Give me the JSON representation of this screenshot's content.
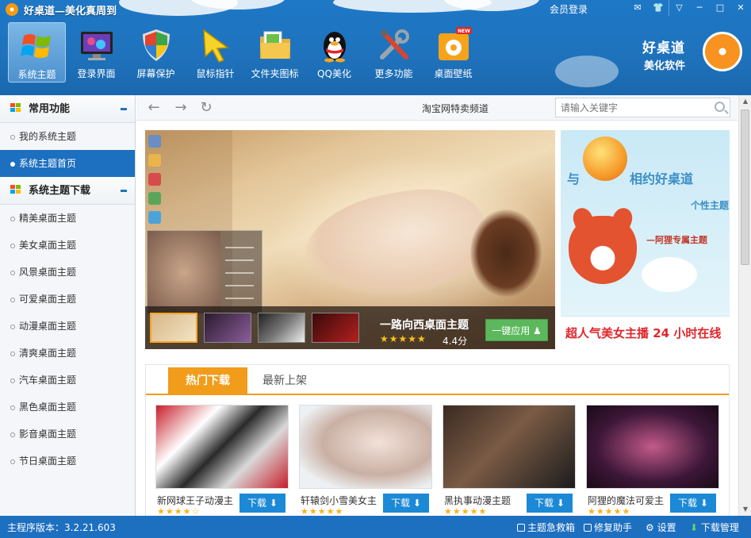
{
  "window": {
    "title": "好桌道—美化真周到",
    "member_login": "会员登录",
    "buttons": {
      "message": "✉",
      "skin": "👕",
      "menu": "▽",
      "minimize": "─",
      "maximize": "□",
      "close": "✕"
    }
  },
  "nav": {
    "items": [
      {
        "label": "系统主题",
        "icon": "windows-flag-icon",
        "active": true
      },
      {
        "label": "登录界面",
        "icon": "monitor-icon"
      },
      {
        "label": "屏幕保护",
        "icon": "shield-icon"
      },
      {
        "label": "鼠标指针",
        "icon": "cursor-icon"
      },
      {
        "label": "文件夹图标",
        "icon": "folder-icon"
      },
      {
        "label": "QQ美化",
        "icon": "qq-penguin-icon"
      },
      {
        "label": "更多功能",
        "icon": "tools-icon"
      },
      {
        "label": "桌面壁纸",
        "icon": "wallpaper-icon",
        "badge": "NEW"
      }
    ]
  },
  "brand": {
    "line1": "好桌道",
    "line2": "美化软件"
  },
  "sidebar": {
    "section1": {
      "title": "常用功能",
      "items": [
        "我的系统主题",
        "系统主题首页"
      ],
      "active_index": 1
    },
    "section2": {
      "title": "系统主题下载",
      "items": [
        "精美桌面主题",
        "美女桌面主题",
        "风景桌面主题",
        "可爱桌面主题",
        "动漫桌面主题",
        "清爽桌面主题",
        "汽车桌面主题",
        "黑色桌面主题",
        "影音桌面主题",
        "节日桌面主题"
      ]
    }
  },
  "browser": {
    "back": "←",
    "forward": "→",
    "refresh": "↻",
    "page_title": "淘宝网特卖频道",
    "search_placeholder": "请输入关键字"
  },
  "banner": {
    "name": "一路向西桌面主题",
    "stars": "★★★★★",
    "score": "4.4分",
    "apply_label": "一键应用"
  },
  "ad": {
    "text1": "与",
    "text2": "相约好桌道",
    "text3": "个性主题",
    "text4": "—阿狸专属主题",
    "text5": "超人气美女主播 24 小时在线"
  },
  "tabs": {
    "hot": "热门下载",
    "new": "最新上架"
  },
  "cards": [
    {
      "name": "新网球王子动漫主",
      "stars": "★★★★☆",
      "download": "下载"
    },
    {
      "name": "轩辕剑小雪美女主",
      "stars": "★★★★★",
      "download": "下载"
    },
    {
      "name": "黑执事动漫主题",
      "stars": "★★★★★",
      "download": "下载"
    },
    {
      "name": "阿狸的魔法可爱主",
      "stars": "★★★★★",
      "download": "下载"
    }
  ],
  "status": {
    "version": "主程序版本：3.2.21.603",
    "emergency": "主题急救箱",
    "repair": "修复助手",
    "settings": "设置",
    "downloads": "下载管理"
  },
  "colors": {
    "primary_blue": "#1d6fc0",
    "accent_orange": "#f19c1a",
    "apply_green": "#5cb85c",
    "download_blue": "#1c89d6"
  }
}
